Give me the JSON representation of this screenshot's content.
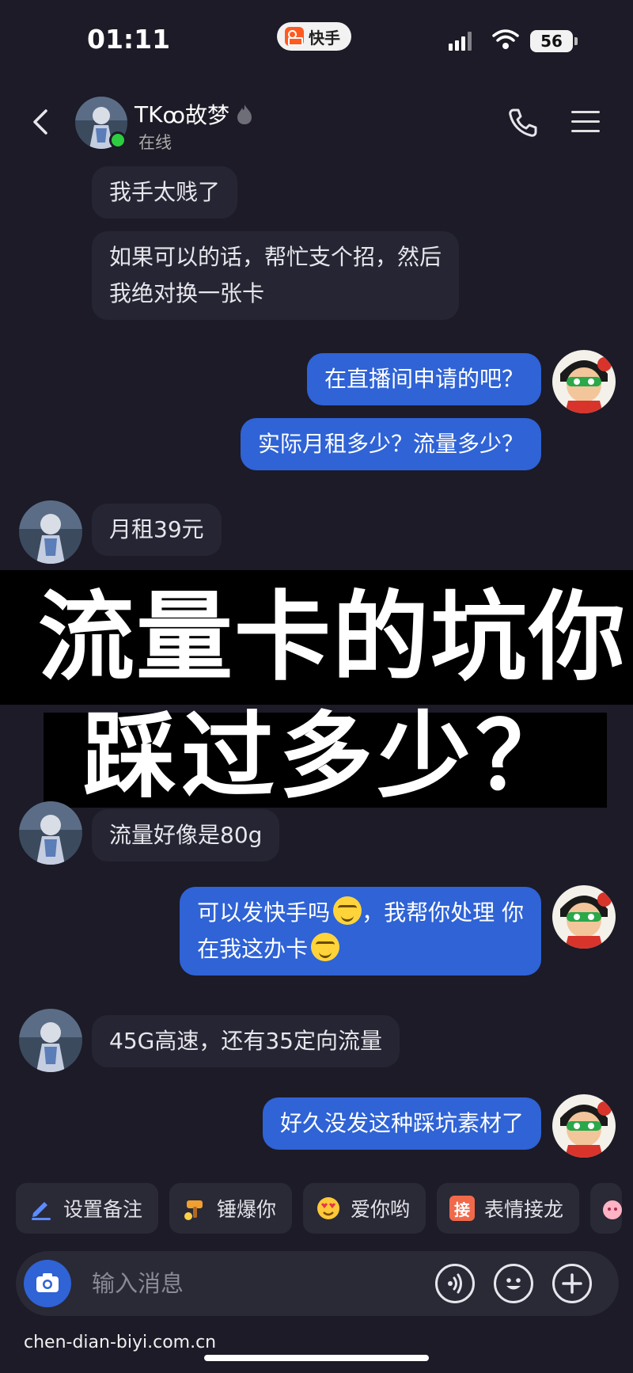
{
  "status_bar": {
    "time": "01:11",
    "app_name": "快手",
    "battery": "56",
    "icons": [
      "kuaishou-logo",
      "signal",
      "wifi",
      "battery"
    ]
  },
  "header": {
    "contact_name": "TK",
    "contact_name_suffix": "ꝏ故梦",
    "status": "在线",
    "icons": [
      "back-icon",
      "flame-icon",
      "call-icon",
      "menu-icon"
    ]
  },
  "messages": [
    {
      "side": "incoming",
      "text": "我手太贱了"
    },
    {
      "side": "incoming",
      "lines": [
        "如果可以的话，帮忙支个招，然后",
        "我绝对换一张卡"
      ]
    },
    {
      "side": "outgoing",
      "text": "在直播间申请的吧？"
    },
    {
      "side": "outgoing",
      "text": "实际月租多少？流量多少？"
    },
    {
      "side": "incoming",
      "text": "月租39元"
    },
    {
      "side": "incoming",
      "text": "流量好像是80g"
    },
    {
      "side": "outgoing",
      "lines": [
        "可以发快手吗",
        "，我帮你处理 你",
        "在我这办卡"
      ]
    },
    {
      "side": "incoming",
      "text": "45G高速，还有35定向流量"
    },
    {
      "side": "outgoing",
      "text": "好久没发这种踩坑素材了"
    }
  ],
  "overlay": {
    "line1": "流量卡的坑你",
    "line2": "踩过多少？"
  },
  "quick_actions": [
    {
      "label": "设置备注",
      "icon": "pencil-icon"
    },
    {
      "label": "锤爆你",
      "icon": "hammer-icon"
    },
    {
      "label": "爱你哟",
      "icon": "heart-eyes-icon"
    },
    {
      "label": "表情接龙",
      "icon": "jie-badge-icon",
      "badge": "接"
    }
  ],
  "input": {
    "placeholder": "输入消息",
    "icons": [
      "camera-icon",
      "voice-icon",
      "emoji-icon",
      "plus-icon"
    ]
  },
  "watermark": "chen-dian-biyi.com.cn",
  "colors": {
    "background": "#1c1b27",
    "incoming_bubble": "#262533",
    "outgoing_bubble": "#2f63d6",
    "online": "#2ecc40",
    "banner": "#000000"
  }
}
